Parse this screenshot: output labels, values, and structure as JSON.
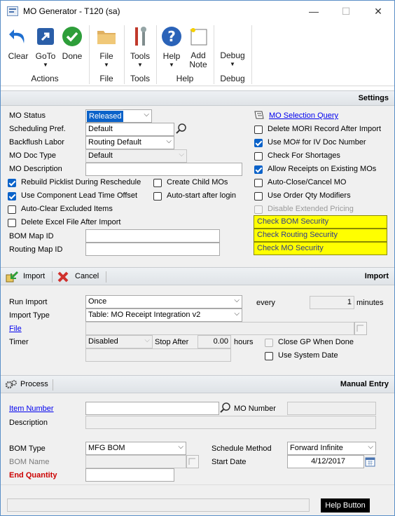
{
  "window": {
    "title": "MO Generator  -  T120 (sa)",
    "minimize": "—",
    "maximize": "☐",
    "close": "✕"
  },
  "ribbon": {
    "buttons": {
      "clear": "Clear",
      "goto": "GoTo",
      "done": "Done",
      "file": "File",
      "tools": "Tools",
      "help": "Help",
      "add_note_1": "Add",
      "add_note_2": "Note",
      "debug": "Debug"
    },
    "groups": {
      "actions": "Actions",
      "file": "File",
      "tools": "Tools",
      "help": "Help",
      "debug": "Debug"
    }
  },
  "settings": {
    "header": "Settings",
    "mo_status_label": "MO Status",
    "mo_status_value": "Released",
    "sched_pref_label": "Scheduling Pref.",
    "sched_pref_value": "Default",
    "backflush_label": "Backflush Labor",
    "backflush_value": "Routing Default",
    "mo_doc_type_label": "MO Doc Type",
    "mo_doc_type_value": "Default",
    "mo_desc_label": "MO Description",
    "mo_desc_value": "",
    "rebuild_picklist": "Rebuild Picklist During Reschedule",
    "create_child": "Create Child MOs",
    "use_component_lead": "Use Component Lead Time Offset",
    "autostart_login": "Auto-start after login",
    "autoclear_excluded": "Auto-Clear Excluded Items",
    "delete_excel": "Delete Excel File After Import",
    "bom_map_label": "BOM Map ID",
    "routing_map_label": "Routing Map ID",
    "mo_selection_query": "MO Selection Query",
    "delete_mori": "Delete MORI Record After Import",
    "use_mo_number": "Use MO# for IV Doc Number",
    "check_shortages": "Check For Shortages",
    "allow_receipts": "Allow Receipts on Existing MOs",
    "autoclose": "Auto-Close/Cancel MO",
    "use_order_qty": "Use Order Qty Modifiers",
    "disable_ext_pricing": "Disable Extended Pricing",
    "check_bom": "Check BOM Security",
    "check_routing": "Check Routing Security",
    "check_mo": "Check MO Security"
  },
  "import": {
    "import_btn": "Import",
    "cancel_btn": "Cancel",
    "header": "Import",
    "run_import_label": "Run Import",
    "run_import_value": "Once",
    "every_label": "every",
    "every_value": "1",
    "minutes_label": "minutes",
    "import_type_label": "Import Type",
    "import_type_value": "Table: MO Receipt Integration v2",
    "file_label": "File",
    "timer_label": "Timer",
    "timer_value": "Disabled",
    "stop_after_label": "Stop After",
    "stop_after_value": "0.00",
    "hours_label": "hours",
    "close_gp": "Close GP When Done",
    "use_system_date": "Use System Date"
  },
  "manual": {
    "process_btn": "Process",
    "header": "Manual Entry",
    "item_number_label": "Item Number",
    "mo_number_label": "MO Number",
    "description_label": "Description",
    "bom_type_label": "BOM Type",
    "bom_type_value": "MFG BOM",
    "schedule_method_label": "Schedule Method",
    "schedule_method_value": "Forward Infinite",
    "bom_name_label": "BOM Name",
    "start_date_label": "Start Date",
    "start_date_value": "4/12/2017",
    "end_qty_label": "End Quantity"
  },
  "status": {
    "help_button": "Help Button"
  },
  "colors": {
    "accent": "#0a62c9",
    "check_bg": "#ffff00",
    "end_qty": "#cc0000"
  }
}
